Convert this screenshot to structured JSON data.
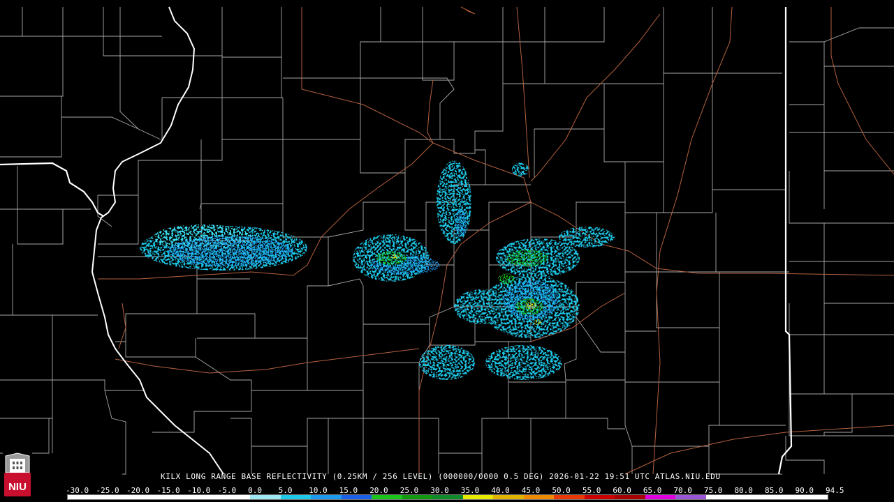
{
  "caption": {
    "text": "KILX LONG RANGE BASE REFLECTIVITY (0.25KM / 256 LEVEL) (000000/0000 0.5 DEG) 2026-01-22 19:51 UTC  ATLAS.NIU.EDU"
  },
  "color_scale": {
    "labels": [
      "-30.0",
      "-25.0",
      "-20.0",
      "-15.0",
      "-10.0",
      "-5.0",
      "0.0",
      "5.0",
      "10.0",
      "15.0",
      "20.0",
      "25.0",
      "30.0",
      "35.0",
      "40.0",
      "45.0",
      "50.0",
      "55.0",
      "60.0",
      "65.0",
      "70.0",
      "75.0",
      "80.0",
      "85.0",
      "90.0",
      "94.5"
    ],
    "colors": [
      "#ffffff",
      "#ffffff",
      "#ffffff",
      "#ffffff",
      "#ffffff",
      "#ffffff",
      "#9fe7f5",
      "#1ec8e8",
      "#1b9bf0",
      "#1a5fe8",
      "#19c41b",
      "#109a10",
      "#0f8a2a",
      "#e8e800",
      "#e0b300",
      "#f08a00",
      "#e83a00",
      "#cc0000",
      "#a80000",
      "#e000e0",
      "#9a55d8",
      "#ffffff",
      "#ffffff",
      "#ffffff",
      "#ffffff"
    ]
  },
  "logo": {
    "text": "NIU",
    "color": "#c8102e"
  },
  "map_colors": {
    "background": "#000000",
    "county_lines": "#a8a8a8",
    "state_lines": "#ffffff",
    "roads": "#b5613f"
  }
}
